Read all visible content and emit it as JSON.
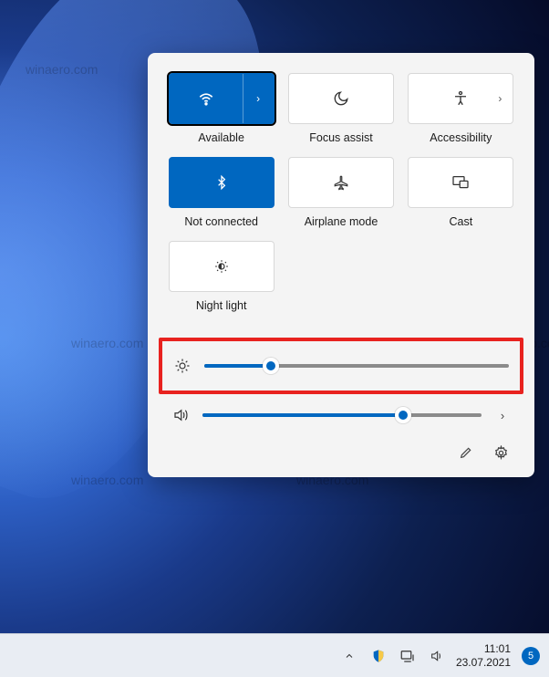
{
  "quick_settings": {
    "tiles": [
      {
        "label": "Available",
        "active": true,
        "split": true,
        "icon": "wifi"
      },
      {
        "label": "Focus assist",
        "active": false,
        "split": false,
        "icon": "moon"
      },
      {
        "label": "Accessibility",
        "active": false,
        "split": false,
        "icon": "accessibility",
        "arrow": true
      },
      {
        "label": "Not connected",
        "active": true,
        "split": false,
        "icon": "bluetooth"
      },
      {
        "label": "Airplane mode",
        "active": false,
        "split": false,
        "icon": "airplane"
      },
      {
        "label": "Cast",
        "active": false,
        "split": false,
        "icon": "cast"
      },
      {
        "label": "Night light",
        "active": false,
        "split": false,
        "icon": "nightlight"
      }
    ],
    "brightness": {
      "value": 22
    },
    "volume": {
      "value": 72
    },
    "highlighted_slider": "brightness"
  },
  "taskbar": {
    "time": "11:01",
    "date": "23.07.2021",
    "notification_count": "5"
  },
  "watermark_text": "winaero.com"
}
